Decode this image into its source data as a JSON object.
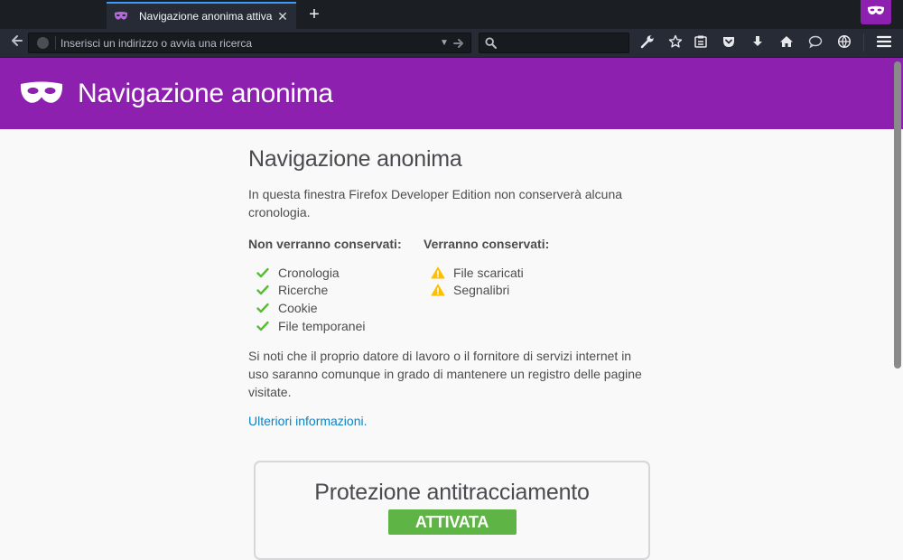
{
  "tab": {
    "title": "Navigazione anonima attiva",
    "close_symbol": "✕",
    "icon": "mask-icon"
  },
  "newtab": {
    "symbol": "+"
  },
  "urlbar": {
    "placeholder": "Inserisci un indirizzo o avvia una ricerca",
    "value": ""
  },
  "searchbar": {
    "placeholder": "",
    "value": ""
  },
  "toolbar": {
    "icons": [
      "wrench-icon",
      "bookmark-star-icon",
      "reader-list-icon",
      "pocket-icon",
      "downloads-icon",
      "home-icon",
      "chat-icon",
      "webide-icon",
      "hamburger-menu-icon"
    ]
  },
  "header": {
    "title": "Navigazione anonima"
  },
  "content": {
    "title": "Navigazione anonima",
    "intro": "In questa finestra Firefox Developer Edition non conserverà alcuna cronologia.",
    "not_saved_heading": "Non verranno conservati:",
    "not_saved_items": [
      "Cronologia",
      "Ricerche",
      "Cookie",
      "File temporanei"
    ],
    "saved_heading": "Verranno conservati:",
    "saved_items": [
      "File scaricati",
      "Segnalibri"
    ],
    "note": "Si noti che il proprio datore di lavoro o il fornitore di servizi internet in uso saranno comunque in grado di mantenere un registro delle pagine visitate.",
    "learn_more": "Ulteriori informazioni."
  },
  "tracking_protection": {
    "title": "Protezione antitracciamento",
    "status": "ATTIVATA"
  },
  "colors": {
    "private_purple": "#8d20ae",
    "chrome_dark": "#272b35",
    "check_green": "#57bd35",
    "warning_yellow": "#ffbf00",
    "link_blue": "#0a84c6",
    "status_green": "#5eb444"
  }
}
